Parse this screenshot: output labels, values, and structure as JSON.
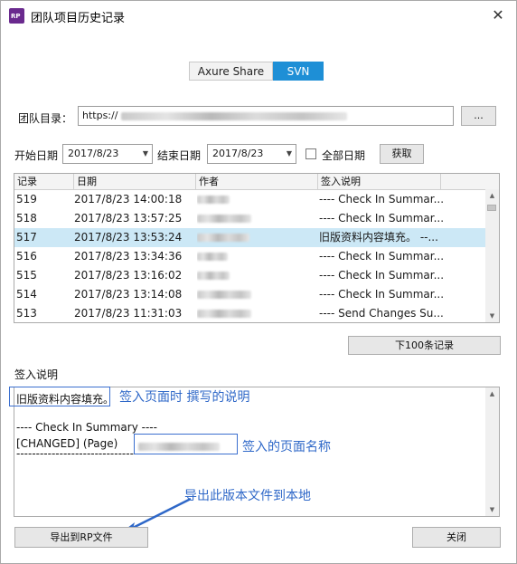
{
  "window": {
    "title": "团队项目历史记录",
    "app_icon_text": "RP",
    "close_glyph": "✕"
  },
  "tabs": [
    {
      "label": "Axure Share",
      "active": false
    },
    {
      "label": "SVN",
      "active": true
    }
  ],
  "directory": {
    "label": "团队目录：",
    "value_prefix": "https://",
    "browse_label": "..."
  },
  "filter": {
    "start_label": "开始日期",
    "start_value": "2017/8/23",
    "end_label": "结束日期",
    "end_value": "2017/8/23",
    "all_dates_label": "全部日期",
    "fetch_label": "获取"
  },
  "table": {
    "columns": [
      "记录",
      "日期",
      "作者",
      "签入说明"
    ],
    "rows": [
      {
        "record": "519",
        "date": "2017/8/23 14:00:18",
        "note": "---- Check In Summar..."
      },
      {
        "record": "518",
        "date": "2017/8/23 13:57:25",
        "note": "---- Check In Summar..."
      },
      {
        "record": "517",
        "date": "2017/8/23 13:53:24",
        "note": "旧版资料内容填充。  --..."
      },
      {
        "record": "516",
        "date": "2017/8/23 13:34:36",
        "note": "---- Check In Summar..."
      },
      {
        "record": "515",
        "date": "2017/8/23 13:16:02",
        "note": "---- Check In Summar..."
      },
      {
        "record": "514",
        "date": "2017/8/23 13:14:08",
        "note": "---- Check In Summar..."
      },
      {
        "record": "513",
        "date": "2017/8/23 11:31:03",
        "note": "---- Send Changes Su..."
      }
    ],
    "selected_index": 2
  },
  "next_button": "下100条记录",
  "description": {
    "label": "签入说明",
    "line1": "旧版资料内容填充。",
    "line2": "---- Check In Summary ----",
    "line3": "[CHANGED]  (Page)",
    "line4": "------------------------------"
  },
  "annotations": {
    "note1": "签入页面时 撰写的说明",
    "note2": "签入的页面名称",
    "note3": "导出此版本文件到本地"
  },
  "footer": {
    "export_label": "导出到RP文件",
    "close_label": "关闭"
  },
  "colors": {
    "accent": "#1e8fd6",
    "selected_row": "#cce8f6",
    "annotation": "#2f68c8"
  }
}
